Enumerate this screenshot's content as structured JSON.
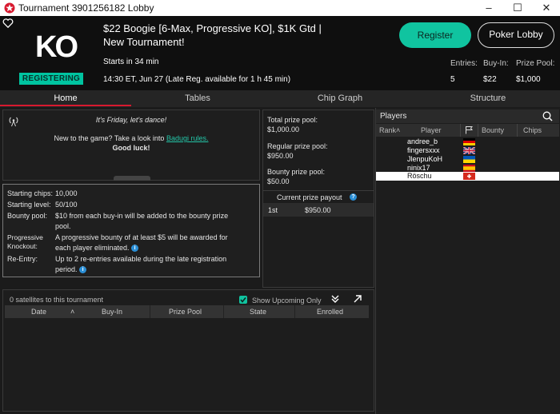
{
  "window": {
    "title": "Tournament 3901256182 Lobby"
  },
  "header": {
    "logo_text": "KO",
    "status_badge": "REGISTERING",
    "title": "$22 Boogie [6-Max, Progressive KO], $1K Gtd | New Tournament!",
    "starts": "Starts in 34 min",
    "date_line": "14:30 ET, Jun 27 (Late Reg. available for 1 h 45 min)",
    "register_label": "Register",
    "poker_lobby_label": "Poker Lobby",
    "stats": [
      {
        "label": "Entries:",
        "value": "5"
      },
      {
        "label": "Buy-In:",
        "value": "$22"
      },
      {
        "label": "Prize Pool:",
        "value": "$1,000"
      }
    ]
  },
  "tabs": [
    "Home",
    "Tables",
    "Chip Graph",
    "Structure"
  ],
  "home": {
    "message_title": "It's Friday, let's dance!",
    "message_line1": "New to the game? Take a look into",
    "message_link": "Badugi rules.",
    "message_bold": "Good luck!",
    "details": [
      {
        "label": "Starting chips:",
        "value": "10,000"
      },
      {
        "label": "Starting level:",
        "value": "50/100"
      },
      {
        "label": "Bounty pool:",
        "value": "$10 from each buy-in will be added to the bounty prize",
        "value2": "pool."
      },
      {
        "label": "Progressive",
        "label2": "Knockout:",
        "value": "A progressive bounty of at least $5 will be awarded for",
        "value2": "each player eliminated."
      },
      {
        "label": "Re-Entry:",
        "value": "Up to 2 re-entries available during the late registration",
        "value2": "period."
      }
    ]
  },
  "prize": {
    "total_label": "Total prize pool:",
    "total_value": "$1,000.00",
    "regular_label": "Regular prize pool:",
    "regular_value": "$950.00",
    "bounty_label": "Bounty prize pool:",
    "bounty_value": "$50.00",
    "payout_header": "Current prize payout",
    "payouts": [
      {
        "place": "1st",
        "amount": "$950.00"
      }
    ]
  },
  "players": {
    "title": "Players",
    "columns": [
      "Rank",
      "Player",
      "Bounty",
      "Chips"
    ],
    "rows": [
      {
        "name": "andree_b",
        "flag": "germany"
      },
      {
        "name": "fingersxxx",
        "flag": "uk"
      },
      {
        "name": "JlenpuKoH",
        "flag": "ukraine"
      },
      {
        "name": "ninix17",
        "flag": "spain"
      },
      {
        "name": "Röschu",
        "flag": "switzerland"
      }
    ]
  },
  "satellites": {
    "count_text": "0 satellites to this tournament",
    "show_upcoming_label": "Show Upcoming Only",
    "show_upcoming_checked": true,
    "columns": [
      "Date",
      "Buy-In",
      "Prize Pool",
      "State",
      "Enrolled"
    ]
  },
  "colors": {
    "accent": "#10c4a0",
    "tab_active": "#d8192f"
  }
}
